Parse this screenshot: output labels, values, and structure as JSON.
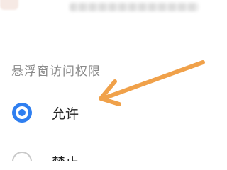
{
  "section": {
    "title": "悬浮窗访问权限"
  },
  "options": [
    {
      "label": "允许",
      "selected": true
    },
    {
      "label": "禁止",
      "selected": false
    }
  ],
  "colors": {
    "accent": "#2f7ff0",
    "annotation_arrow": "#f0a14a",
    "section_title": "#8a8a8a"
  },
  "icons": {
    "annotation": "arrow-pointer-icon"
  }
}
